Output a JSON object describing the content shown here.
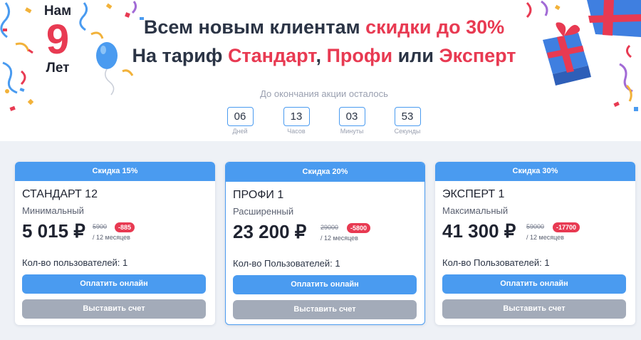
{
  "banner": {
    "age": {
      "top": "Нам",
      "number": "9",
      "bottom": "Лет"
    },
    "headline": {
      "line1_prefix": "Всем новым клиентам ",
      "line1_accent": "скидки до 30%",
      "line2_prefix": "На тариф ",
      "line2_plan1": "Стандарт",
      "line2_sep": ", ",
      "line2_plan2": "Профи",
      "line2_or": " или ",
      "line2_plan3": "Эксперт"
    },
    "countdown": {
      "label": "До окончания акции осталось",
      "units": [
        {
          "value": "06",
          "label": "Дней"
        },
        {
          "value": "13",
          "label": "Часов"
        },
        {
          "value": "03",
          "label": "Минуты"
        },
        {
          "value": "53",
          "label": "Секунды"
        }
      ]
    }
  },
  "plans": [
    {
      "discount": "Скидка 15%",
      "name": "СТАНДАРТ 12",
      "subtitle": "Минимальный",
      "price": "5 015 ₽",
      "old_price": "5900",
      "saving": "-885",
      "period": "/ 12 месяцев",
      "users": "Кол-во пользователей: 1",
      "pay_label": "Оплатить онлайн",
      "invoice_label": "Выставить счет"
    },
    {
      "discount": "Скидка 20%",
      "name": "ПРОФИ 1",
      "subtitle": "Расширенный",
      "price": "23 200 ₽",
      "old_price": "29000",
      "saving": "-5800",
      "period": "/ 12 месяцев",
      "users": "Кол-во Пользователей: 1",
      "pay_label": "Оплатить онлайн",
      "invoice_label": "Выставить счет"
    },
    {
      "discount": "Скидка 30%",
      "name": "ЭКСПЕРТ 1",
      "subtitle": "Максимальный",
      "price": "41 300 ₽",
      "old_price": "59000",
      "saving": "-17700",
      "period": "/ 12 месяцев",
      "users": "Кол-во Пользователей: 1",
      "pay_label": "Оплатить онлайн",
      "invoice_label": "Выставить счет"
    }
  ],
  "colors": {
    "accent_red": "#e83a52",
    "brand_blue": "#4a9bf0",
    "invoice_gray": "#a3abb9",
    "section_bg": "#eef1f6"
  },
  "icons": [
    "balloon-icon",
    "gift-box-icon",
    "confetti-decoration"
  ]
}
